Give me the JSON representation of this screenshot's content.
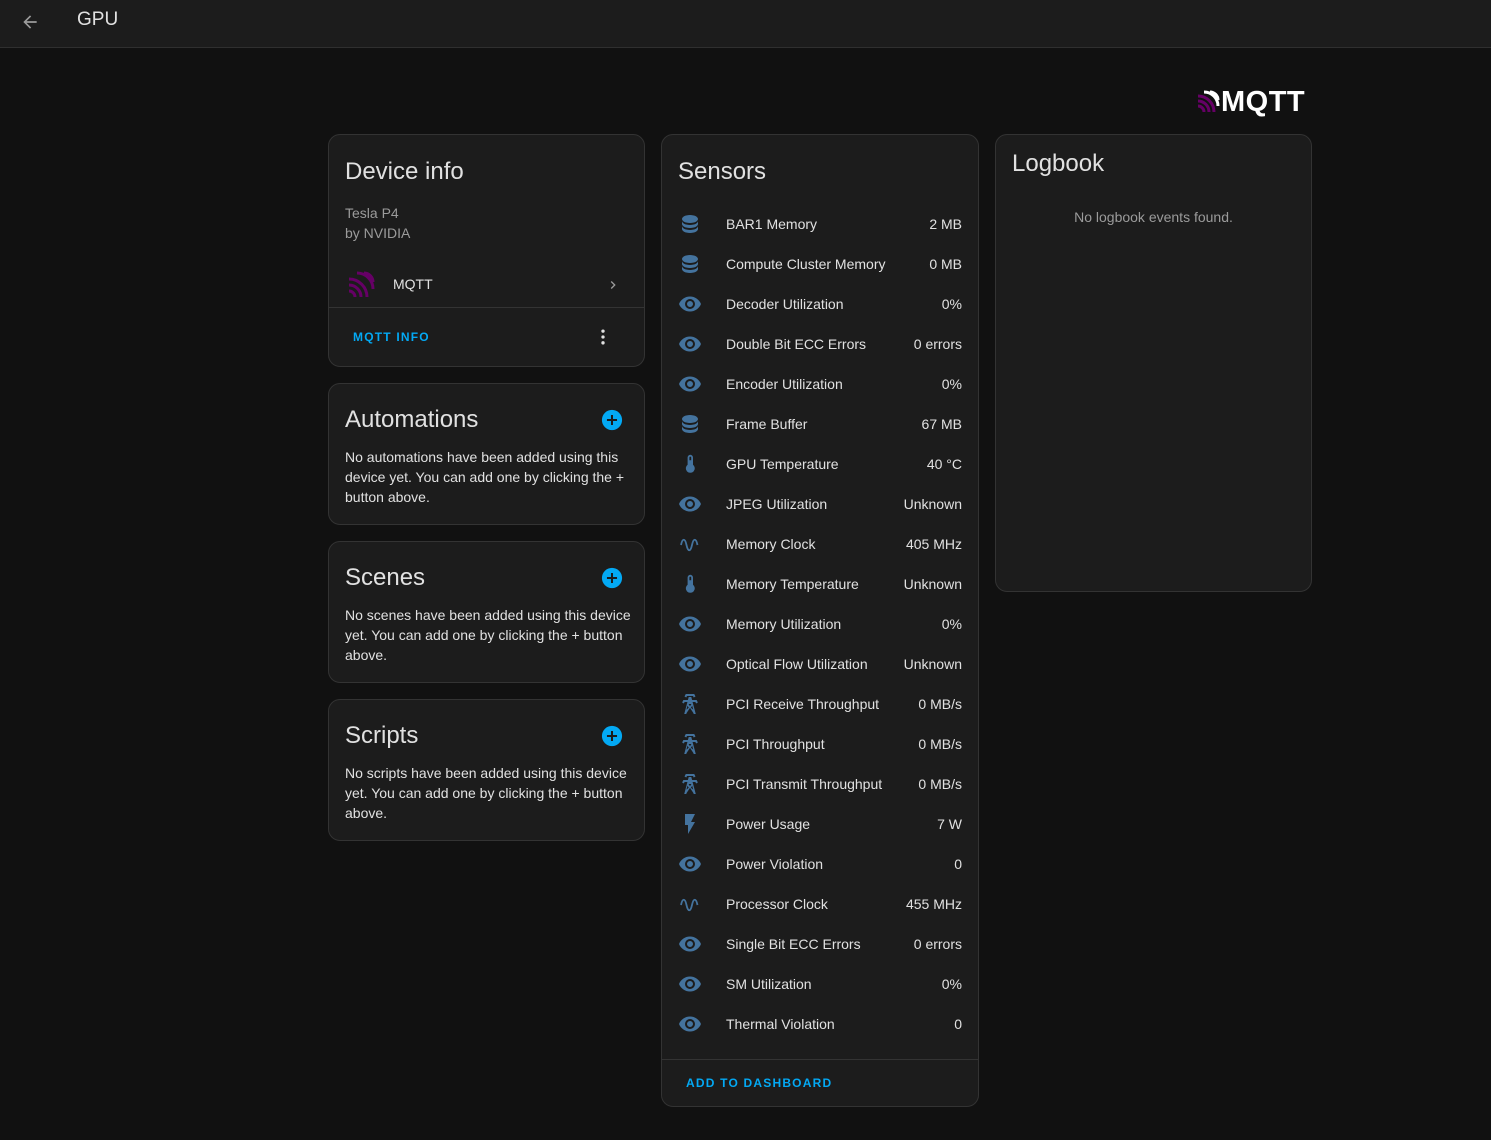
{
  "header": {
    "title": "GPU"
  },
  "brand": {
    "logo_text": "MQTT",
    "accent_color": "#03a9f4",
    "mqtt_color": "#660066"
  },
  "device_info": {
    "title": "Device info",
    "model": "Tesla P4",
    "manufacturer": "by NVIDIA",
    "integration": "MQTT",
    "mqtt_info_label": "MQTT INFO"
  },
  "automations": {
    "title": "Automations",
    "description": "No automations have been added using this device yet. You can add one by clicking the + button above."
  },
  "scenes": {
    "title": "Scenes",
    "description": "No scenes have been added using this device yet. You can add one by clicking the + button above."
  },
  "scripts": {
    "title": "Scripts",
    "description": "No scripts have been added using this device yet. You can add one by clicking the + button above."
  },
  "sensors": {
    "title": "Sensors",
    "add_to_dashboard_label": "ADD TO DASHBOARD",
    "items": [
      {
        "name": "BAR1 Memory",
        "value": "2 MB",
        "icon": "database-icon"
      },
      {
        "name": "Compute Cluster Memory",
        "value": "0 MB",
        "icon": "database-icon"
      },
      {
        "name": "Decoder Utilization",
        "value": "0%",
        "icon": "eye-icon"
      },
      {
        "name": "Double Bit ECC Errors",
        "value": "0 errors",
        "icon": "eye-icon"
      },
      {
        "name": "Encoder Utilization",
        "value": "0%",
        "icon": "eye-icon"
      },
      {
        "name": "Frame Buffer",
        "value": "67 MB",
        "icon": "database-icon"
      },
      {
        "name": "GPU Temperature",
        "value": "40 °C",
        "icon": "thermometer-icon"
      },
      {
        "name": "JPEG Utilization",
        "value": "Unknown",
        "icon": "eye-icon"
      },
      {
        "name": "Memory Clock",
        "value": "405 MHz",
        "icon": "sine-wave-icon"
      },
      {
        "name": "Memory Temperature",
        "value": "Unknown",
        "icon": "thermometer-icon"
      },
      {
        "name": "Memory Utilization",
        "value": "0%",
        "icon": "eye-icon"
      },
      {
        "name": "Optical Flow Utilization",
        "value": "Unknown",
        "icon": "eye-icon"
      },
      {
        "name": "PCI Receive Throughput",
        "value": "0 MB/s",
        "icon": "transmission-tower-icon"
      },
      {
        "name": "PCI Throughput",
        "value": "0 MB/s",
        "icon": "transmission-tower-icon"
      },
      {
        "name": "PCI Transmit Throughput",
        "value": "0 MB/s",
        "icon": "transmission-tower-icon"
      },
      {
        "name": "Power Usage",
        "value": "7 W",
        "icon": "flash-icon"
      },
      {
        "name": "Power Violation",
        "value": "0",
        "icon": "eye-icon"
      },
      {
        "name": "Processor Clock",
        "value": "455 MHz",
        "icon": "sine-wave-icon"
      },
      {
        "name": "Single Bit ECC Errors",
        "value": "0 errors",
        "icon": "eye-icon"
      },
      {
        "name": "SM Utilization",
        "value": "0%",
        "icon": "eye-icon"
      },
      {
        "name": "Thermal Violation",
        "value": "0",
        "icon": "eye-icon"
      }
    ]
  },
  "logbook": {
    "title": "Logbook",
    "empty_text": "No logbook events found."
  }
}
